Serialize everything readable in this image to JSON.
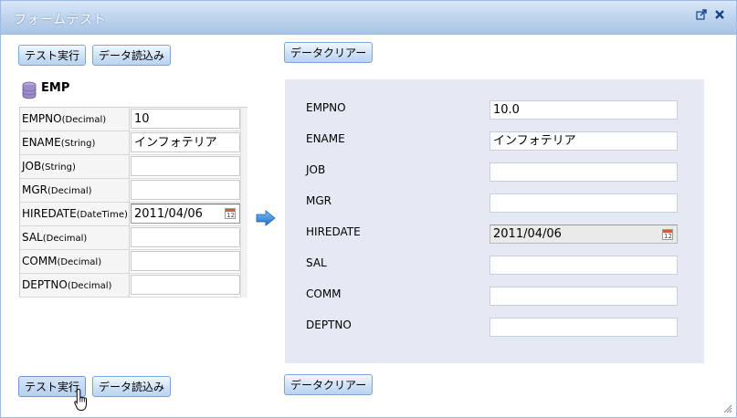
{
  "window": {
    "title": "フォームテスト"
  },
  "buttons": {
    "test_run": "テスト実行",
    "data_load": "データ読込み",
    "data_clear": "データクリアー"
  },
  "left_panel": {
    "table_name": "EMP",
    "fields": [
      {
        "name": "EMPNO",
        "type": "(Decimal)",
        "value": "10"
      },
      {
        "name": "ENAME",
        "type": "(String)",
        "value": "インフォテリア"
      },
      {
        "name": "JOB",
        "type": "(String)",
        "value": ""
      },
      {
        "name": "MGR",
        "type": "(Decimal)",
        "value": ""
      },
      {
        "name": "HIREDATE",
        "type": "(DateTime)",
        "value": "2011/04/06"
      },
      {
        "name": "SAL",
        "type": "(Decimal)",
        "value": ""
      },
      {
        "name": "COMM",
        "type": "(Decimal)",
        "value": ""
      },
      {
        "name": "DEPTNO",
        "type": "(Decimal)",
        "value": ""
      }
    ]
  },
  "right_panel": {
    "fields": [
      {
        "label": "EMPNO",
        "value": "10.0"
      },
      {
        "label": "ENAME",
        "value": "インフォテリア"
      },
      {
        "label": "JOB",
        "value": ""
      },
      {
        "label": "MGR",
        "value": ""
      },
      {
        "label": "HIREDATE",
        "value": "2011/04/06"
      },
      {
        "label": "SAL",
        "value": ""
      },
      {
        "label": "COMM",
        "value": ""
      },
      {
        "label": "DEPTNO",
        "value": ""
      }
    ]
  },
  "calendar_icon_text": "12",
  "colors": {
    "titlebar": "#a9c4e6",
    "button": "#cfe1f5",
    "panel": "#e4e9f4",
    "arrow": "#2f86d6"
  }
}
